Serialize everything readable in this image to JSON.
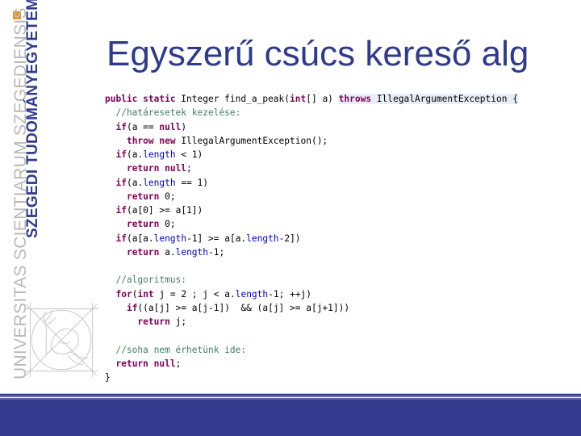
{
  "sidebar": {
    "logo_square_color": "#e8961e",
    "university_name_latin_light": "UNIVERSITAS SCIENTIARUM ",
    "university_name_latin_bold": "SZEGEDIENSIS",
    "university_name_hu_light": "",
    "university_name_hu_bold": "SZEGEDI TUDOMÁNYEGYETEM",
    "emblem": "university-emblem-icon"
  },
  "slide": {
    "title": "Egyszerű csúcs kereső alg",
    "code_lines": [
      [
        {
          "t": "public static ",
          "c": "kw"
        },
        {
          "t": "Integer find_a_peak(",
          "c": ""
        },
        {
          "t": "int",
          "c": "kw"
        },
        {
          "t": "[] a) ",
          "c": ""
        },
        {
          "t": "throws",
          "c": "kw hl"
        },
        {
          "t": " IllegalArgumentException {",
          "c": "hl"
        }
      ],
      [
        {
          "t": "  //határesetek kezelése:",
          "c": "cm"
        }
      ],
      [
        {
          "t": "  ",
          "c": ""
        },
        {
          "t": "if",
          "c": "kw"
        },
        {
          "t": "(a == ",
          "c": ""
        },
        {
          "t": "null",
          "c": "kw"
        },
        {
          "t": ")",
          "c": ""
        }
      ],
      [
        {
          "t": "    ",
          "c": ""
        },
        {
          "t": "throw new ",
          "c": "kw"
        },
        {
          "t": "IllegalArgumentException();",
          "c": ""
        }
      ],
      [
        {
          "t": "  ",
          "c": ""
        },
        {
          "t": "if",
          "c": "kw"
        },
        {
          "t": "(a.",
          "c": ""
        },
        {
          "t": "length",
          "c": "fld"
        },
        {
          "t": " < 1)",
          "c": ""
        }
      ],
      [
        {
          "t": "    ",
          "c": ""
        },
        {
          "t": "return null",
          "c": "kw"
        },
        {
          "t": ";",
          "c": ""
        }
      ],
      [
        {
          "t": "  ",
          "c": ""
        },
        {
          "t": "if",
          "c": "kw"
        },
        {
          "t": "(a.",
          "c": ""
        },
        {
          "t": "length",
          "c": "fld"
        },
        {
          "t": " == 1)",
          "c": ""
        }
      ],
      [
        {
          "t": "    ",
          "c": ""
        },
        {
          "t": "return",
          "c": "kw"
        },
        {
          "t": " 0;",
          "c": ""
        }
      ],
      [
        {
          "t": "  ",
          "c": ""
        },
        {
          "t": "if",
          "c": "kw"
        },
        {
          "t": "(a[0] >= a[1])",
          "c": ""
        }
      ],
      [
        {
          "t": "    ",
          "c": ""
        },
        {
          "t": "return",
          "c": "kw"
        },
        {
          "t": " 0;",
          "c": ""
        }
      ],
      [
        {
          "t": "  ",
          "c": ""
        },
        {
          "t": "if",
          "c": "kw"
        },
        {
          "t": "(a[a.",
          "c": ""
        },
        {
          "t": "length",
          "c": "fld"
        },
        {
          "t": "-1] >= a[a.",
          "c": ""
        },
        {
          "t": "length",
          "c": "fld"
        },
        {
          "t": "-2])",
          "c": ""
        }
      ],
      [
        {
          "t": "    ",
          "c": ""
        },
        {
          "t": "return",
          "c": "kw"
        },
        {
          "t": " a.",
          "c": ""
        },
        {
          "t": "length",
          "c": "fld"
        },
        {
          "t": "-1;",
          "c": ""
        }
      ],
      [
        {
          "t": "",
          "c": ""
        }
      ],
      [
        {
          "t": "  //algoritmus:",
          "c": "cm"
        }
      ],
      [
        {
          "t": "  ",
          "c": ""
        },
        {
          "t": "for",
          "c": "kw"
        },
        {
          "t": "(",
          "c": ""
        },
        {
          "t": "int",
          "c": "kw"
        },
        {
          "t": " j = 2 ; j < a.",
          "c": ""
        },
        {
          "t": "length",
          "c": "fld"
        },
        {
          "t": "-1; ++j)",
          "c": ""
        }
      ],
      [
        {
          "t": "    ",
          "c": ""
        },
        {
          "t": "if",
          "c": "kw"
        },
        {
          "t": "((a[j] >= a[j-1])  && (a[j] >= a[j+1]))",
          "c": ""
        }
      ],
      [
        {
          "t": "      ",
          "c": ""
        },
        {
          "t": "return",
          "c": "kw"
        },
        {
          "t": " j;",
          "c": ""
        }
      ],
      [
        {
          "t": "",
          "c": ""
        }
      ],
      [
        {
          "t": "  //soha nem érhetünk ide:",
          "c": "cm"
        }
      ],
      [
        {
          "t": "  ",
          "c": ""
        },
        {
          "t": "return null",
          "c": "kw"
        },
        {
          "t": ";",
          "c": ""
        }
      ],
      [
        {
          "t": "}",
          "c": ""
        }
      ]
    ]
  },
  "colors": {
    "title": "#2e3a8c",
    "keyword": "#7f0055",
    "comment": "#3f7f5f",
    "field": "#0000c0",
    "footer_bar": "#343b8f"
  }
}
